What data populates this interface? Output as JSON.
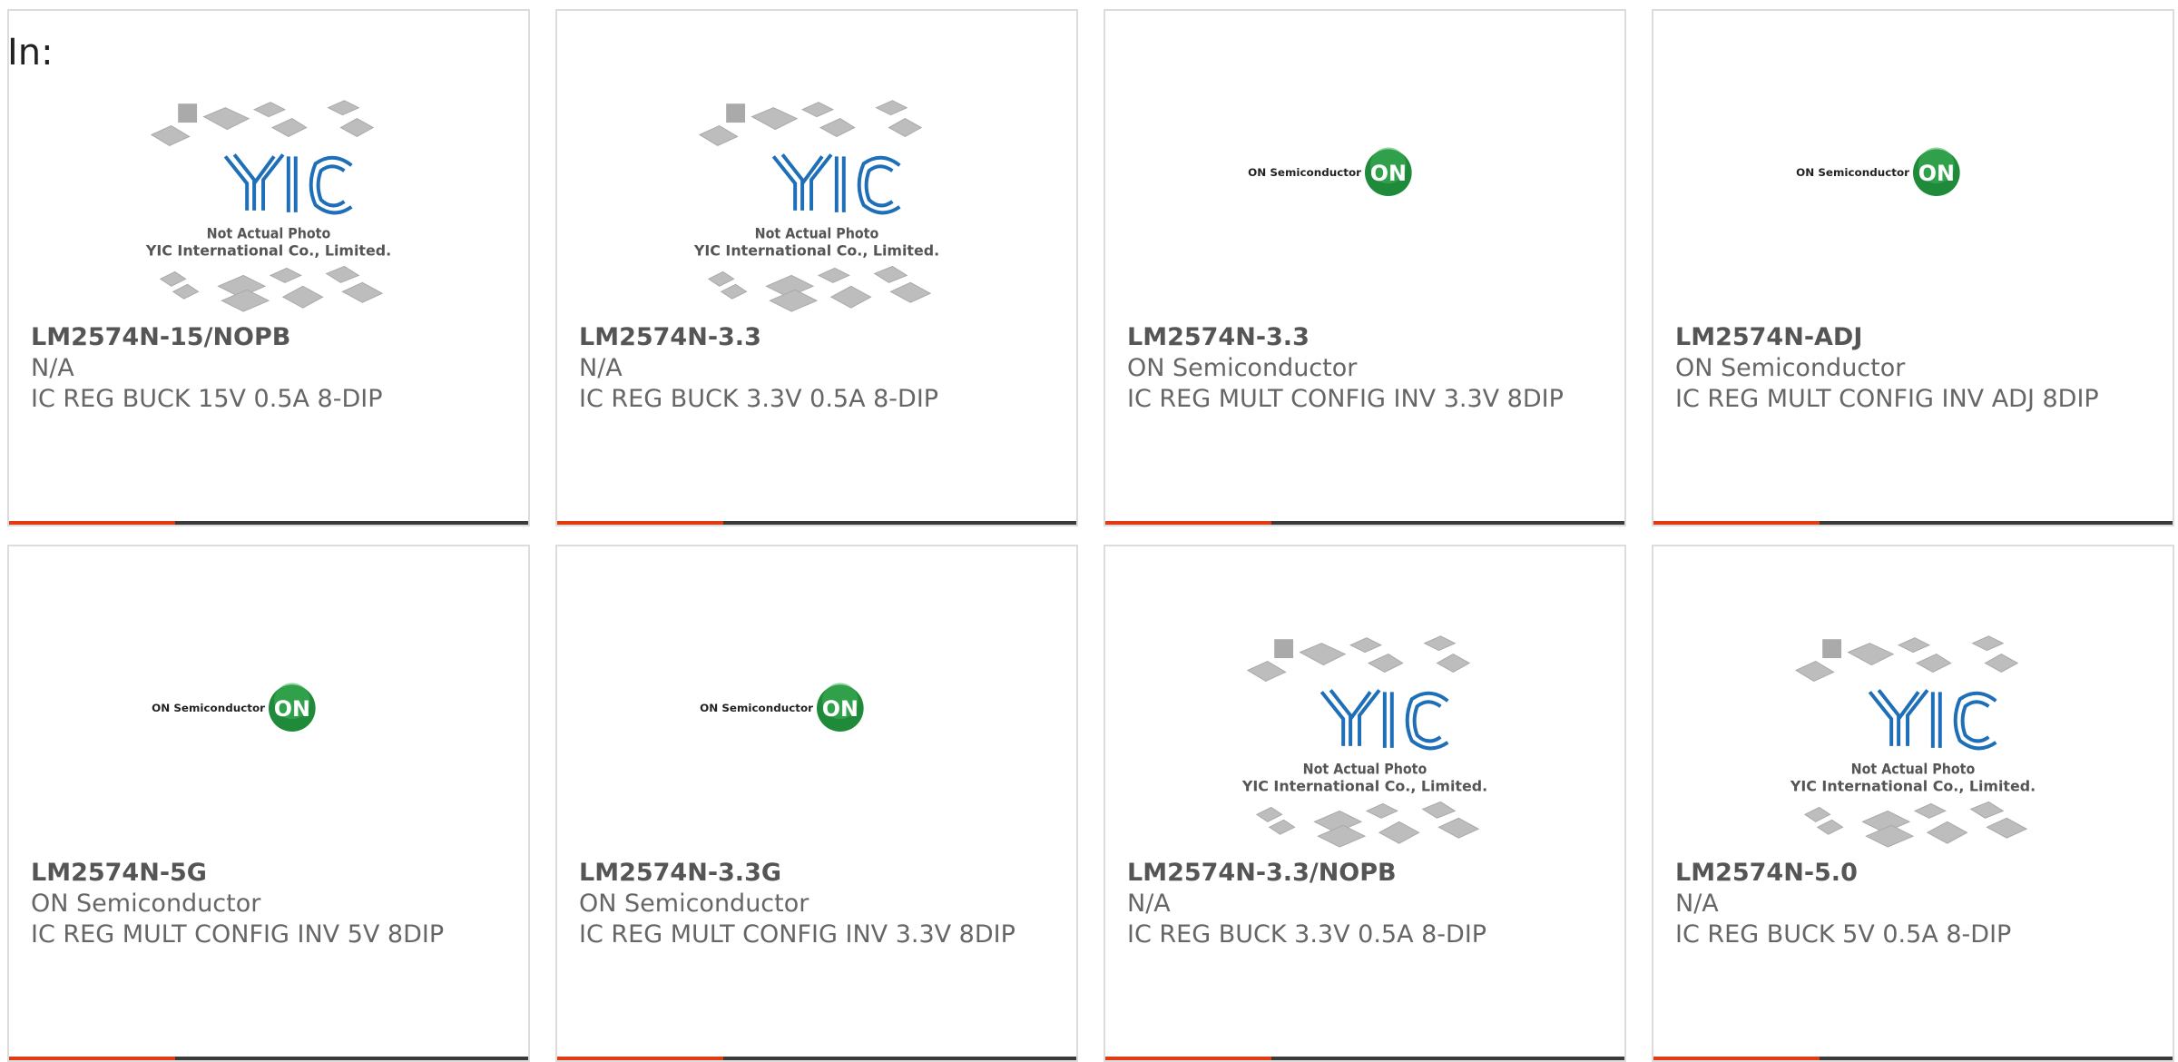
{
  "header": {
    "label": "In:"
  },
  "placeholders": {
    "yic": {
      "line1": "Not Actual Photo",
      "line2": "YIC International Co., Limited.",
      "logo": "YIC"
    },
    "on": {
      "text": "ON Semiconductor",
      "badge": "ON"
    }
  },
  "colors": {
    "accent": "#e23a12",
    "bar": "#3a3a3a",
    "on_green": "#1f8a3a",
    "yic_blue": "#1e6fb8"
  },
  "products": [
    {
      "part": "LM2574N-15/NOPB",
      "maker": "N/A",
      "desc": "IC REG BUCK 15V 0.5A 8-DIP",
      "image": "yic-placeholder"
    },
    {
      "part": "LM2574N-3.3",
      "maker": "N/A",
      "desc": "IC REG BUCK 3.3V 0.5A 8-DIP",
      "image": "yic-placeholder"
    },
    {
      "part": "LM2574N-3.3",
      "maker": "ON Semiconductor",
      "desc": "IC REG MULT CONFIG INV 3.3V 8DIP",
      "image": "on-semiconductor-logo"
    },
    {
      "part": "LM2574N-ADJ",
      "maker": "ON Semiconductor",
      "desc": "IC REG MULT CONFIG INV ADJ 8DIP",
      "image": "on-semiconductor-logo"
    },
    {
      "part": "LM2574N-5G",
      "maker": "ON Semiconductor",
      "desc": "IC REG MULT CONFIG INV 5V 8DIP",
      "image": "on-semiconductor-logo"
    },
    {
      "part": "LM2574N-3.3G",
      "maker": "ON Semiconductor",
      "desc": "IC REG MULT CONFIG INV 3.3V 8DIP",
      "image": "on-semiconductor-logo"
    },
    {
      "part": "LM2574N-3.3/NOPB",
      "maker": "N/A",
      "desc": "IC REG BUCK 3.3V 0.5A 8-DIP",
      "image": "yic-placeholder"
    },
    {
      "part": "LM2574N-5.0",
      "maker": "N/A",
      "desc": "IC REG BUCK 5V 0.5A 8-DIP",
      "image": "yic-placeholder"
    }
  ]
}
